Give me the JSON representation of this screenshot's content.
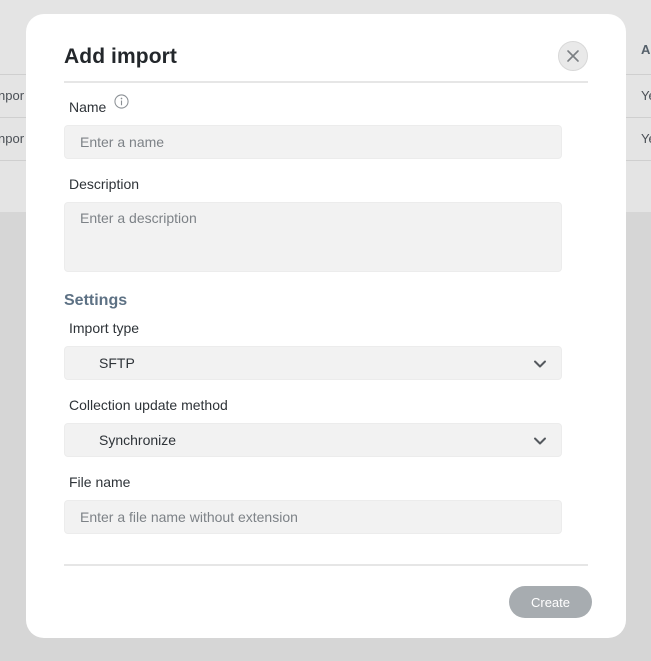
{
  "background": {
    "header_cell": "A",
    "rows": [
      {
        "left": "npor",
        "right": "Ye"
      },
      {
        "left": "npor",
        "right": "Ye"
      }
    ]
  },
  "modal": {
    "title": "Add import",
    "close_icon": "close-icon",
    "name": {
      "label": "Name",
      "placeholder": "Enter a name",
      "info_icon": "info-icon"
    },
    "description": {
      "label": "Description",
      "placeholder": "Enter a description"
    },
    "settings": {
      "title": "Settings",
      "import_type": {
        "label": "Import type",
        "value": "SFTP"
      },
      "collection_update_method": {
        "label": "Collection update method",
        "value": "Synchronize"
      },
      "file_name": {
        "label": "File name",
        "placeholder": "Enter a file name without extension"
      }
    },
    "create_label": "Create"
  },
  "colors": {
    "overlay": "#d6d6d6",
    "modal_bg": "#ffffff",
    "field_bg": "#f2f2f2",
    "section_title": "#5d7184",
    "create_button_disabled": "#a7acb0"
  }
}
